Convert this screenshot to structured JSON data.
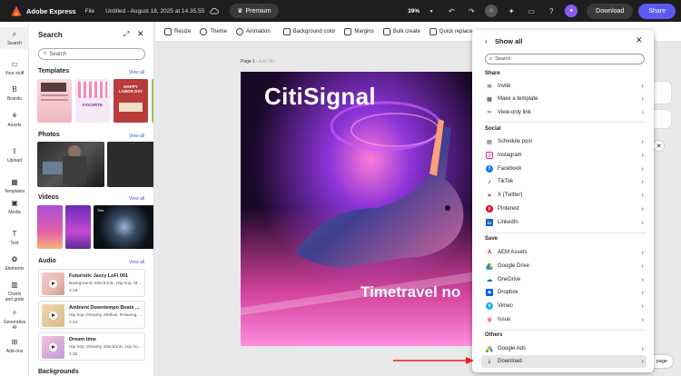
{
  "topbar": {
    "app_name": "Adobe Express",
    "file_menu": "File",
    "doc_title": "Untitled - August 18, 2025 at 14.35.55",
    "premium_label": "Premium",
    "zoom": "39%",
    "download_label": "Download",
    "share_label": "Share"
  },
  "rail": {
    "items": [
      {
        "label": "Search"
      },
      {
        "label": "Your stuff"
      },
      {
        "label": "Brands"
      },
      {
        "label": "Assets"
      },
      {
        "label": "Upload"
      },
      {
        "label": "Templates"
      },
      {
        "label": "Media"
      },
      {
        "label": "Text"
      },
      {
        "label": "Elements"
      },
      {
        "label": "Charts and grids"
      },
      {
        "label": "Generative AI"
      },
      {
        "label": "Add-ons"
      }
    ]
  },
  "panel": {
    "title": "Search",
    "search_placeholder": "Search",
    "templates_label": "Templates",
    "photos_label": "Photos",
    "videos_label": "Videos",
    "audio_label": "Audio",
    "backgrounds_label": "Backgrounds",
    "view_all": "View all",
    "template_text_1": "HAPPY LABOR DAY",
    "template_text_2": "FAVORITE",
    "video_badge": "Title",
    "audio": [
      {
        "title": "Futuristic Jazzy LoFi 001",
        "desc": "Background, Electronic, Hip hop, M...",
        "duration": "2:18"
      },
      {
        "title": "Ambient Downtempo Beats ...",
        "desc": "Hip hop, Dreamy, Mellow, Relaxing, ...",
        "duration": "2:23"
      },
      {
        "title": "Dream time",
        "desc": "Hip hop, Dreamy, Electronic, Hip ho...",
        "duration": "2:32"
      }
    ]
  },
  "toolbar": {
    "resize": "Resize",
    "theme": "Theme",
    "animation": "Animation",
    "background_color": "Background color",
    "margins": "Margins",
    "bulk_create": "Bulk create",
    "quick_replace": "Quick replace"
  },
  "canvas": {
    "page_label": "Page 1 -",
    "page_subtitle": "Add title",
    "title": "CitiSignal",
    "subtitle": "Timetravel no"
  },
  "share_menu": {
    "title": "Show all",
    "search_placeholder": "Search",
    "groups": {
      "share": "Share",
      "social": "Social",
      "save": "Save",
      "others": "Others"
    },
    "share_items": [
      "Invite",
      "Make a template",
      "View-only link"
    ],
    "social_items": [
      "Schedule post",
      "Instagram",
      "Facebook",
      "TikTok",
      "X (Twitter)",
      "Pinterest",
      "LinkedIn"
    ],
    "save_items": [
      "AEM Assets",
      "Google Drive",
      "OneDrive",
      "Dropbox",
      "Vimeo",
      "Issuu"
    ],
    "others_items": [
      "Google Ads",
      "Download"
    ]
  },
  "add_page": "page",
  "colors": {
    "accent": "#5b5bf2",
    "topbar": "#1e1e1e",
    "annotation_arrow": "#e8231e"
  }
}
